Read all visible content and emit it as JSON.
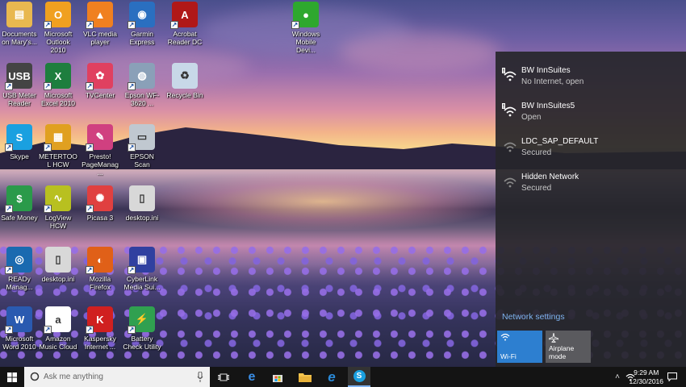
{
  "desktop": {
    "icons": [
      {
        "label": "Documents on Mary's...",
        "icon": "folder-icon",
        "color": "#e8b850"
      },
      {
        "label": "Microsoft Outlook 2010",
        "icon": "outlook-icon",
        "color": "#f0a020"
      },
      {
        "label": "VLC media player",
        "icon": "vlc-cone-icon",
        "color": "#f08020"
      },
      {
        "label": "Garmin Express",
        "icon": "garmin-globe-icon",
        "color": "#2a6fc0"
      },
      {
        "label": "Acrobat Reader DC",
        "icon": "acrobat-icon",
        "color": "#b01818"
      },
      {
        "label": "Windows Mobile Devi...",
        "icon": "windows-mobile-icon",
        "color": "#2ea82e"
      },
      {
        "label": "USB Meter Reader",
        "icon": "usb-icon",
        "color": "#444444"
      },
      {
        "label": "Microsoft Excel 2010",
        "icon": "excel-icon",
        "color": "#1e7e3e"
      },
      {
        "label": "TVCenter",
        "icon": "tvcenter-icon",
        "color": "#e04060"
      },
      {
        "label": "Epson WF-3620 ...",
        "icon": "epson-printer-icon",
        "color": "#8aa0b8"
      },
      {
        "label": "Recycle Bin",
        "icon": "recycle-bin-icon",
        "color": "#c8d8e8"
      },
      {
        "label": "Skype",
        "icon": "skype-icon",
        "color": "#1aa0e0"
      },
      {
        "label": "METERTOOL HCW",
        "icon": "metertool-icon",
        "color": "#e0a020"
      },
      {
        "label": "Presto! PageManag...",
        "icon": "presto-icon",
        "color": "#d04080"
      },
      {
        "label": "EPSON Scan",
        "icon": "epson-scan-icon",
        "color": "#c0c8d0"
      },
      {
        "label": "Safe Money",
        "icon": "safe-money-icon",
        "color": "#2a9a4a"
      },
      {
        "label": "LogView HCW",
        "icon": "logview-icon",
        "color": "#b8c020"
      },
      {
        "label": "Picasa 3",
        "icon": "picasa-icon",
        "color": "#e04040"
      },
      {
        "label": "desktop.ini",
        "icon": "file-icon",
        "color": "#d8d8d8"
      },
      {
        "label": "READy Manag...",
        "icon": "ready-wifi-icon",
        "color": "#1a6ab0"
      },
      {
        "label": "desktop.ini",
        "icon": "file-icon",
        "color": "#d8d8d8"
      },
      {
        "label": "Mozilla Firefox",
        "icon": "firefox-icon",
        "color": "#e06018"
      },
      {
        "label": "CyberLink Media Sui...",
        "icon": "cyberlink-icon",
        "color": "#3040a0"
      },
      {
        "label": "Microsoft Word 2010",
        "icon": "word-icon",
        "color": "#2a5ab0"
      },
      {
        "label": "Amazon Music Cloud",
        "icon": "amazon-icon",
        "color": "#ffffff"
      },
      {
        "label": "Kaspersky Internet ...",
        "icon": "kaspersky-icon",
        "color": "#d02020"
      },
      {
        "label": "Battery Check Utility",
        "icon": "battery-check-icon",
        "color": "#30a050"
      }
    ]
  },
  "network_flyout": {
    "networks": [
      {
        "name": "BW InnSuites",
        "status": "No Internet, open"
      },
      {
        "name": "BW InnSuites5",
        "status": "Open"
      },
      {
        "name": "LDC_SAP_DEFAULT",
        "status": "Secured"
      },
      {
        "name": "Hidden Network",
        "status": "Secured"
      }
    ],
    "settings_link": "Network settings",
    "tiles": [
      {
        "label": "Wi-Fi",
        "active": true,
        "color": "#2d7fd0"
      },
      {
        "label": "Airplane mode",
        "active": false,
        "color": "#5a5a5e"
      }
    ]
  },
  "taskbar": {
    "search_placeholder": "Ask me anything",
    "time": "9:29 AM",
    "date": "12/30/2016"
  }
}
